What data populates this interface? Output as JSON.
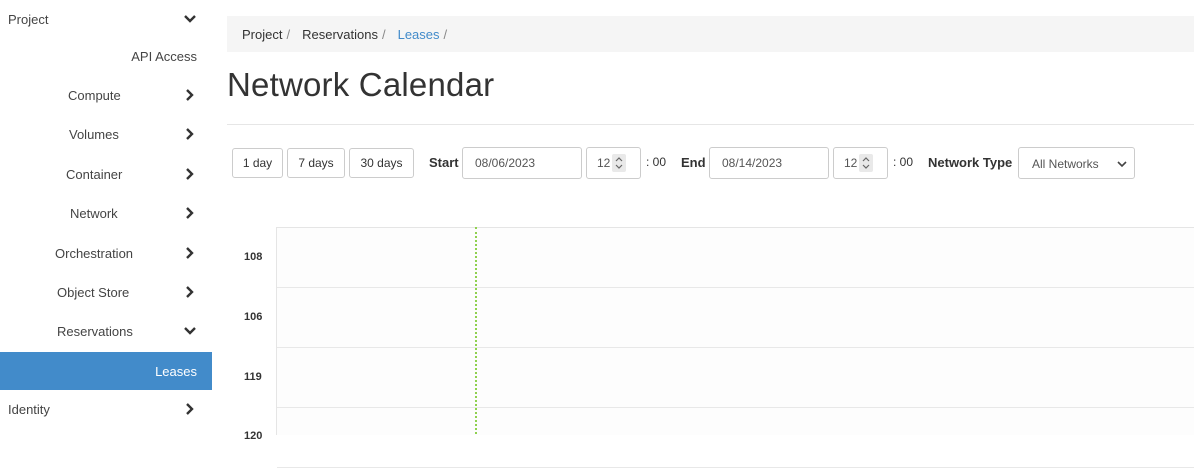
{
  "sidebar": {
    "items": [
      {
        "label": "Project",
        "chevron": "down"
      },
      {
        "label": "API Access",
        "chevron": ""
      },
      {
        "label": "Compute",
        "chevron": "right"
      },
      {
        "label": "Volumes",
        "chevron": "right"
      },
      {
        "label": "Container",
        "chevron": "right"
      },
      {
        "label": "Network",
        "chevron": "right"
      },
      {
        "label": "Orchestration",
        "chevron": "right"
      },
      {
        "label": "Object Store",
        "chevron": "right"
      },
      {
        "label": "Reservations",
        "chevron": "down"
      },
      {
        "label": "Leases",
        "chevron": "",
        "active": true
      },
      {
        "label": "Identity",
        "chevron": "right"
      }
    ]
  },
  "breadcrumb": {
    "items": [
      "Project",
      "Reservations",
      "Leases"
    ],
    "separator": "/"
  },
  "page": {
    "title": "Network Calendar"
  },
  "toolbar": {
    "range_buttons": [
      "1 day",
      "7 days",
      "30 days"
    ],
    "start_label": "Start",
    "start_date": "08/06/2023",
    "start_hour": "12",
    "start_minutes": ": 00",
    "end_label": "End",
    "end_date": "08/14/2023",
    "end_hour": "12",
    "end_minutes": ": 00",
    "network_type_label": "Network Type",
    "network_type_value": "All Networks"
  },
  "calendar": {
    "rows": [
      "108",
      "106",
      "119",
      "120"
    ]
  },
  "colors": {
    "accent": "#428bca",
    "now_line": "#8fd14f"
  }
}
